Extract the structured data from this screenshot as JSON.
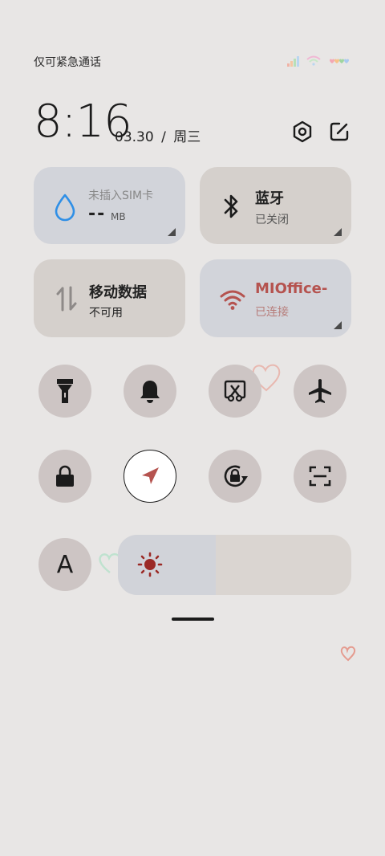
{
  "status_bar": {
    "carrier_text": "仅可紧急通话"
  },
  "header": {
    "time": "8:16",
    "date": "03.30",
    "separator": "/",
    "weekday": "周三"
  },
  "tiles": {
    "sim": {
      "title": "未插入SIM卡",
      "value": "--",
      "unit": "MB",
      "icon": "water-drop-icon"
    },
    "bluetooth": {
      "title": "蓝牙",
      "sub": "已关闭",
      "icon": "bluetooth-icon"
    },
    "mobile_data": {
      "title": "移动数据",
      "sub": "不可用",
      "icon": "data-arrows-icon"
    },
    "wifi": {
      "title": "MIOffice-",
      "sub": "已连接",
      "icon": "wifi-icon",
      "accent": "#b5534f"
    }
  },
  "toggles_row1": [
    "flashlight-icon",
    "bell-icon",
    "screenshot-icon",
    "airplane-icon"
  ],
  "toggles_row2": [
    "lock-icon",
    "location-icon",
    "rotation-lock-icon",
    "scan-icon"
  ],
  "font_toggle": {
    "label": "A"
  },
  "brightness": {
    "level": 0.42,
    "icon": "sun-icon",
    "accent": "#9b2a26"
  },
  "colors": {
    "background": "#e8e6e5",
    "tile_blue": "#d2d4da",
    "tile_beige": "#d5d0cc",
    "round_button": "#cdc5c4"
  }
}
